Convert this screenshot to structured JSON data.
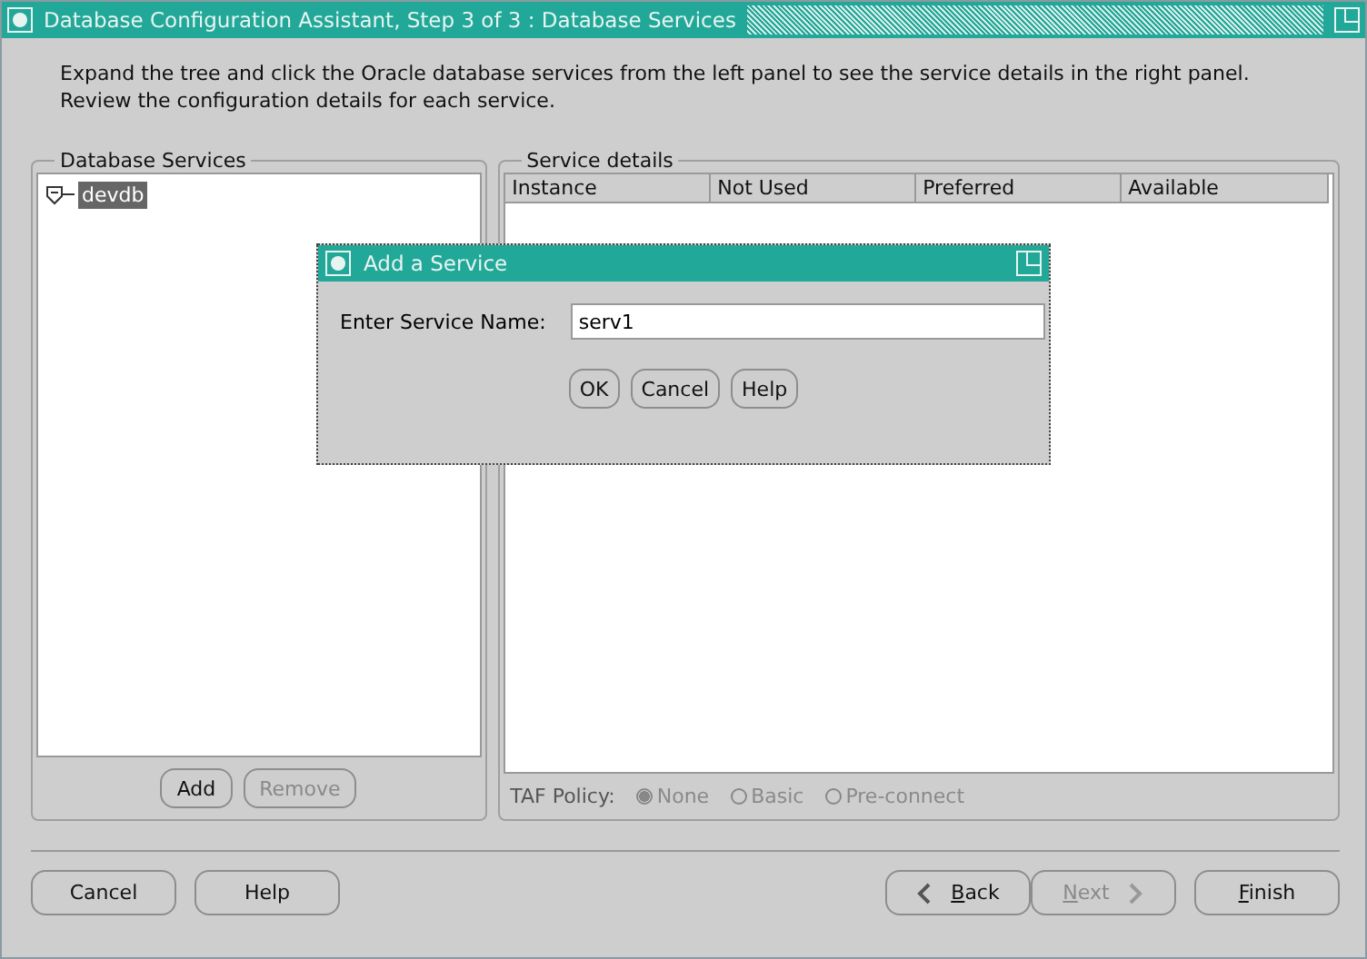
{
  "window": {
    "title": "Database Configuration Assistant, Step 3 of 3 : Database Services"
  },
  "instructions": "Expand the tree and click the Oracle database services from the left panel to see the service details in the right panel.\nReview the configuration details for each service.",
  "services_panel": {
    "title": "Database Services",
    "tree": [
      {
        "label": "devdb",
        "expanded": true,
        "selected": true
      }
    ],
    "buttons": [
      {
        "label": "Add",
        "disabled": false
      },
      {
        "label": "Remove",
        "disabled": true
      }
    ]
  },
  "details_panel": {
    "title": "Service details",
    "table": {
      "columns": [
        "Instance",
        "Not Used",
        "Preferred",
        "Available"
      ]
    },
    "taf_policy": {
      "label": "TAF Policy:",
      "options": [
        {
          "label": "None",
          "selected": true,
          "disabled": true
        },
        {
          "label": "Basic",
          "selected": false,
          "disabled": true
        },
        {
          "label": "Pre-connect",
          "selected": false,
          "disabled": true
        }
      ]
    }
  },
  "footer": {
    "left_buttons": [
      {
        "label": "Cancel",
        "disabled": false,
        "mnemonic": false
      },
      {
        "label": "Help",
        "disabled": false,
        "mnemonic": false
      }
    ],
    "right_buttons": [
      {
        "kind": "back",
        "label": "Back",
        "disabled": false,
        "mnemonic": true
      },
      {
        "kind": "next",
        "label": "Next",
        "disabled": true,
        "mnemonic": true
      },
      {
        "kind": "plain",
        "label": "Finish",
        "disabled": false,
        "mnemonic": true
      }
    ]
  },
  "dialog": {
    "title": "Add a Service",
    "field_label": "Enter Service Name:",
    "field_value": "serv1",
    "buttons": [
      {
        "label": "OK"
      },
      {
        "label": "Cancel"
      },
      {
        "label": "Help"
      }
    ]
  }
}
